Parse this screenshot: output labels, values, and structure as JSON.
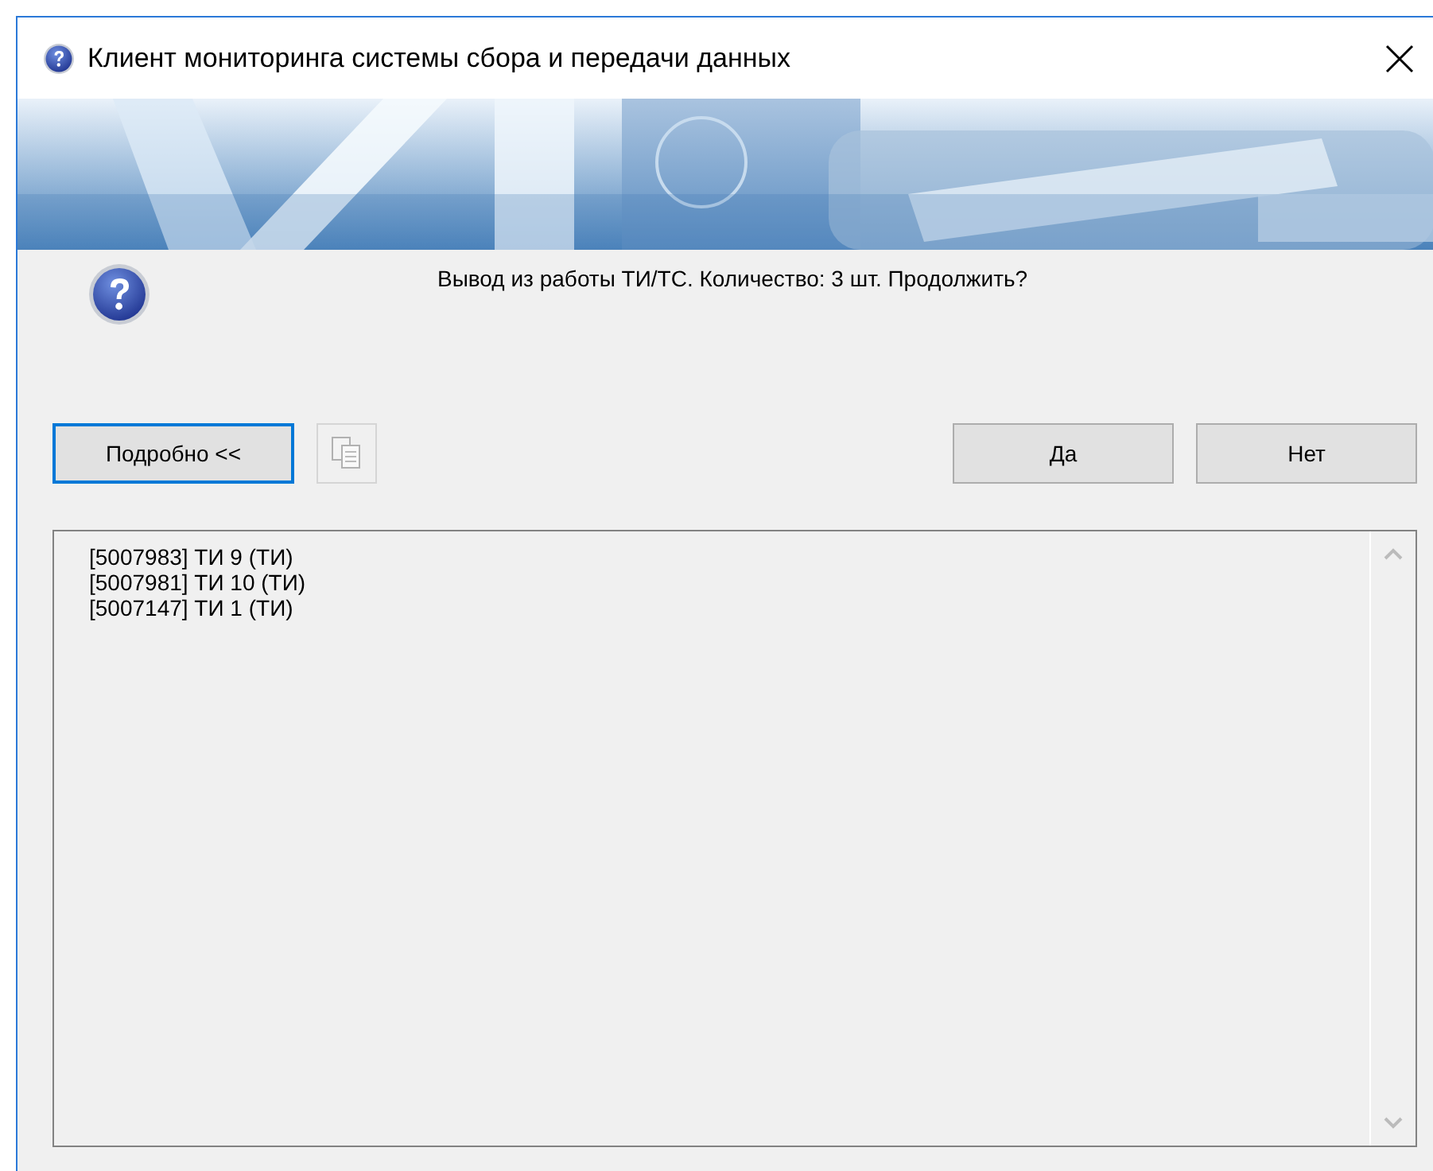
{
  "window": {
    "title": "Клиент мониторинга системы сбора и передачи данных"
  },
  "message": "Вывод из работы ТИ/ТС. Количество: 3 шт. Продолжить?",
  "details_button": {
    "label": "Подробно <<",
    "focused": true
  },
  "copy_button": {
    "disabled": true
  },
  "buttons": [
    {
      "label": "Да",
      "focused": false
    },
    {
      "label": "Нет",
      "focused": false
    }
  ],
  "details": [
    "[5007983] ТИ 9 (ТИ)",
    "[5007981] ТИ 10 (ТИ)",
    "[5007147] ТИ 1 (ТИ)"
  ]
}
